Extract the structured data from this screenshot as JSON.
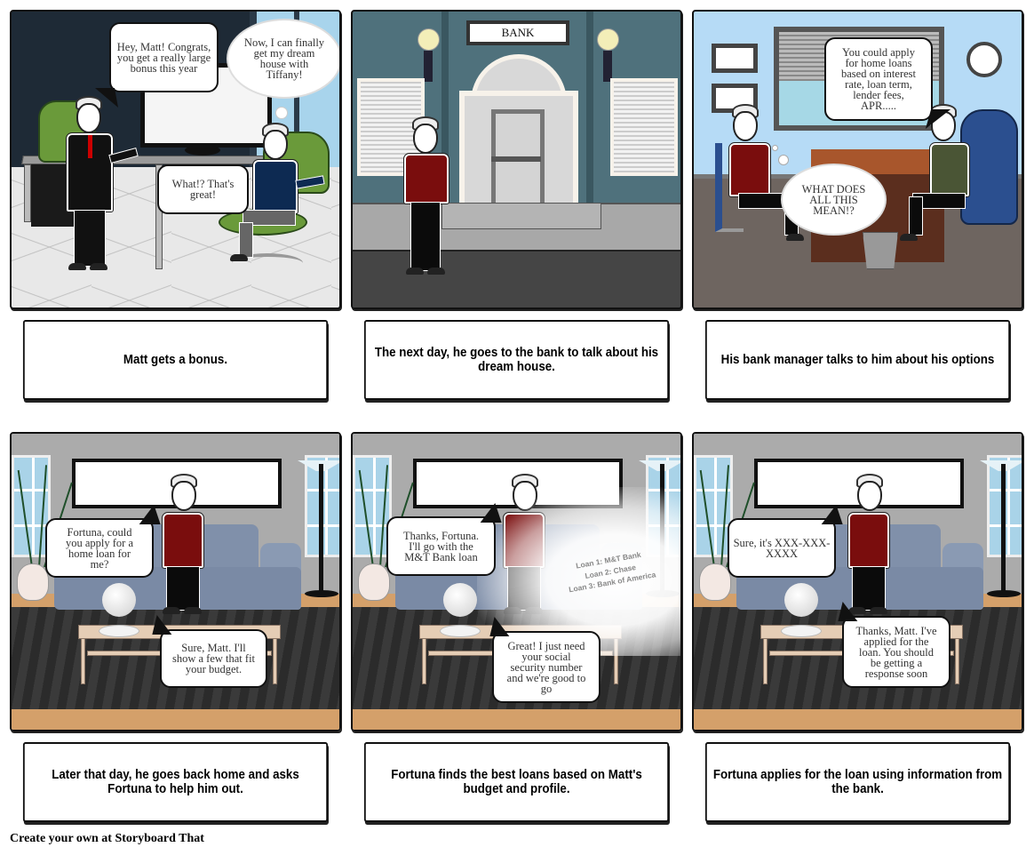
{
  "storyboard": {
    "panels": [
      {
        "scene": "office",
        "bubbles": [
          {
            "type": "speech",
            "text": "Hey, Matt! Congrats, you get a really large bonus this year"
          },
          {
            "type": "thought",
            "text": "Now, I can finally get my dream house with Tiffany!"
          },
          {
            "type": "speech",
            "text": "What!? That's great!"
          }
        ],
        "caption": "Matt gets a bonus."
      },
      {
        "scene": "bank-exterior",
        "sign": "BANK",
        "bubbles": [],
        "caption": "The next day, he goes to the bank to talk about his dream house."
      },
      {
        "scene": "bank-office",
        "bubbles": [
          {
            "type": "speech",
            "text": "You could apply for home loans based on interest rate, loan term, lender fees, APR....."
          },
          {
            "type": "thought",
            "text": "WHAT DOES ALL THIS MEAN!?"
          }
        ],
        "caption": "His bank manager talks to him about his options"
      },
      {
        "scene": "living-room",
        "bubbles": [
          {
            "type": "speech",
            "text": "Fortuna, could you apply for a home loan for me?"
          },
          {
            "type": "speech",
            "text": "Sure, Matt. I'll show a few that fit your budget."
          }
        ],
        "caption": "Later that day, he goes back home and asks Fortuna to help him out."
      },
      {
        "scene": "living-room",
        "bubbles": [
          {
            "type": "speech",
            "text": "Thanks, Fortuna. I'll go with the M&T Bank loan"
          },
          {
            "type": "speech",
            "text": "Great! I just need your social security number and we're good to go"
          }
        ],
        "hologram": [
          "Loan 1: M&T Bank",
          "Loan 2: Chase",
          "Loan 3: Bank of America"
        ],
        "caption": "Fortuna finds the best loans based on Matt's budget and profile."
      },
      {
        "scene": "living-room",
        "bubbles": [
          {
            "type": "speech",
            "text": "Sure, it's XXX-XXX-XXXX"
          },
          {
            "type": "speech",
            "text": "Thanks, Matt. I've applied for the loan. You should be getting a response soon"
          }
        ],
        "caption": "Fortuna applies for the loan using information from the bank."
      }
    ]
  },
  "footer": {
    "text": "Create your own at Storyboard That"
  },
  "colors": {
    "office_wall": "#1e2a36",
    "bank_wall": "#4f717c",
    "bank_office_wall": "#b6dbf6",
    "bank_office_floor": "#6e6560",
    "shirt_red": "#7a0d0d",
    "sweater_green": "#4a5535",
    "chair_green": "#6a9a3a",
    "chair_blue": "#2b4f8f",
    "floor_wood": "#d4a06a"
  }
}
